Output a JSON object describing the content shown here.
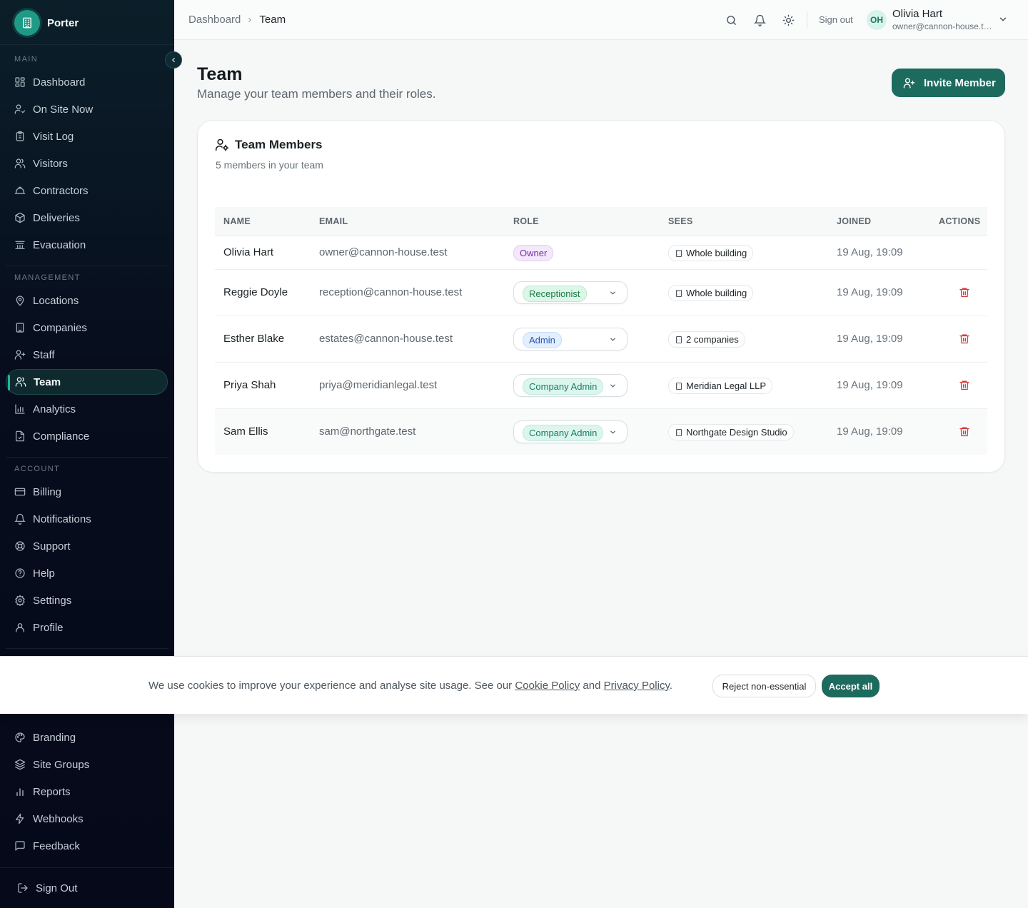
{
  "brand": {
    "name": "Porter"
  },
  "sidebar": {
    "sections": {
      "main": "MAIN",
      "management": "MANAGEMENT",
      "account": "ACCOUNT"
    },
    "items": [
      {
        "label": "Dashboard",
        "icon": "dashboard-icon"
      },
      {
        "label": "On Site Now",
        "icon": "user-check-icon"
      },
      {
        "label": "Visit Log",
        "icon": "clipboard-icon"
      },
      {
        "label": "Visitors",
        "icon": "users-icon"
      },
      {
        "label": "Contractors",
        "icon": "hard-hat-icon"
      },
      {
        "label": "Deliveries",
        "icon": "package-icon"
      },
      {
        "label": "Evacuation",
        "icon": "siren-icon"
      },
      {
        "label": "Locations",
        "icon": "map-pin-icon"
      },
      {
        "label": "Companies",
        "icon": "building-icon"
      },
      {
        "label": "Staff",
        "icon": "user-plus-icon"
      },
      {
        "label": "Team",
        "icon": "users-icon"
      },
      {
        "label": "Analytics",
        "icon": "bar-chart-icon"
      },
      {
        "label": "Compliance",
        "icon": "file-check-icon"
      },
      {
        "label": "Billing",
        "icon": "credit-card-icon"
      },
      {
        "label": "Notifications",
        "icon": "bell-icon"
      },
      {
        "label": "Support",
        "icon": "life-buoy-icon"
      },
      {
        "label": "Help",
        "icon": "help-circle-icon"
      },
      {
        "label": "Settings",
        "icon": "gear-icon"
      },
      {
        "label": "Profile",
        "icon": "user-icon"
      },
      {
        "label": "Branding",
        "icon": "palette-icon"
      },
      {
        "label": "Site Groups",
        "icon": "layers-icon"
      },
      {
        "label": "Reports",
        "icon": "chart-column-icon"
      },
      {
        "label": "Webhooks",
        "icon": "zap-icon"
      },
      {
        "label": "Feedback",
        "icon": "message-square-icon"
      }
    ],
    "active": "Team",
    "sign_out": "Sign Out"
  },
  "topbar": {
    "breadcrumb": [
      "Dashboard",
      "Team"
    ],
    "sign_out": "Sign out",
    "user": {
      "initials": "OH",
      "name": "Olivia Hart",
      "email": "owner@cannon-house.test"
    }
  },
  "page": {
    "title": "Team",
    "subtitle": "Manage your team members and their roles.",
    "invite_button": "Invite Member"
  },
  "card": {
    "title": "Team Members",
    "subtitle": "5 members in your team",
    "columns": [
      "NAME",
      "EMAIL",
      "ROLE",
      "SEES",
      "JOINED",
      "ACTIONS"
    ],
    "rows": [
      {
        "name": "Olivia Hart",
        "email": "owner@cannon-house.test",
        "role": "Owner",
        "editable": false,
        "sees": "Whole building",
        "joined": "19 Aug, 19:09"
      },
      {
        "name": "Reggie Doyle",
        "email": "reception@cannon-house.test",
        "role": "Receptionist",
        "editable": true,
        "sees": "Whole building",
        "joined": "19 Aug, 19:09"
      },
      {
        "name": "Esther Blake",
        "email": "estates@cannon-house.test",
        "role": "Admin",
        "editable": true,
        "sees": "2 companies",
        "joined": "19 Aug, 19:09"
      },
      {
        "name": "Priya Shah",
        "email": "priya@meridianlegal.test",
        "role": "Company Admin",
        "editable": true,
        "sees": "Meridian Legal LLP",
        "joined": "19 Aug, 19:09"
      },
      {
        "name": "Sam Ellis",
        "email": "sam@northgate.test",
        "role": "Company Admin",
        "editable": true,
        "sees": "Northgate Design Studio",
        "joined": "19 Aug, 19:09"
      }
    ]
  },
  "cookie": {
    "text_before": "We use cookies to improve your experience and analyse site usage. See our ",
    "cookie_policy": "Cookie Policy",
    "and": " and ",
    "privacy_policy": "Privacy Policy",
    "period": ".",
    "reject": "Reject non-essential",
    "accept": "Accept all"
  },
  "colors": {
    "accent": "#1d6a5e",
    "sidebar_bg": "#070d1d",
    "brand": "#1f9a86",
    "danger": "#d93a3a"
  }
}
